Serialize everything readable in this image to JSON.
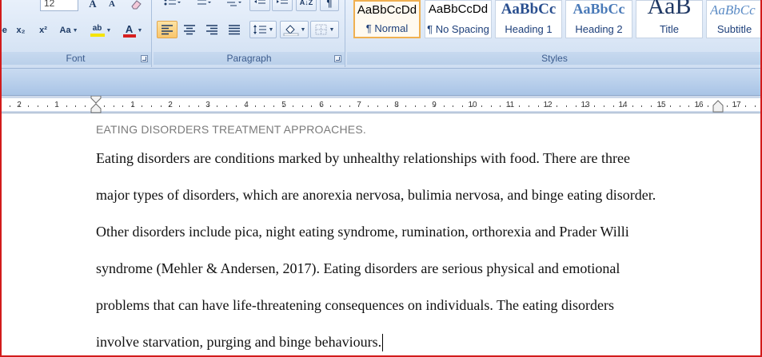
{
  "ribbon": {
    "font_group": {
      "label": "Font",
      "font_size": "12",
      "grow_label": "A",
      "shrink_label": "A",
      "strike_label": "abe",
      "subscript_label": "x₂",
      "superscript_label": "x²",
      "change_case_label": "Aa",
      "highlight_label": "ab",
      "font_color_label": "A",
      "highlight_color": "#f5e400",
      "font_color": "#d61f1f"
    },
    "paragraph_group": {
      "label": "Paragraph",
      "sort_label": "A↓Z",
      "show_marks_label": "¶"
    },
    "styles_group": {
      "label": "Styles",
      "styles": [
        {
          "sample": "AaBbCcDd",
          "name": "¶ Normal",
          "selected": true
        },
        {
          "sample": "AaBbCcDd",
          "name": "¶ No Spacing",
          "selected": false
        },
        {
          "sample": "AaBbCc",
          "name": "Heading 1",
          "selected": false
        },
        {
          "sample": "AaBbCc",
          "name": "Heading 2",
          "selected": false
        },
        {
          "sample": "AaB",
          "name": "Title",
          "selected": false
        },
        {
          "sample": "AaBbCc",
          "name": "Subtitle",
          "selected": false
        }
      ]
    }
  },
  "ruler": {
    "left_numbers": [
      "2",
      "1"
    ],
    "right_numbers": [
      "1",
      "2",
      "3",
      "4",
      "5",
      "6",
      "7",
      "8",
      "9",
      "10",
      "11",
      "12",
      "13",
      "14",
      "15",
      "16",
      "17"
    ]
  },
  "document": {
    "heading": "EATING DISORDERS TREATMENT APPROACHES.",
    "lines": [
      "Eating disorders are conditions marked by unhealthy relationships with food. There are three",
      "major types of disorders, which are anorexia nervosa, bulimia nervosa, and binge eating disorder.",
      "Other disorders include pica, night eating syndrome, rumination, orthorexia and Prader Willi",
      "syndrome (Mehler & Andersen, 2017). Eating disorders are serious physical and emotional",
      "problems that can have life-threatening consequences on individuals.  The eating disorders",
      "involve starvation, purging and binge behaviours."
    ]
  },
  "colors": {
    "frame": "#d21b1b",
    "ribbon_text": "#1e3b66",
    "style_name_text": "#1d3f7a",
    "heading_text": "#7b7b7b"
  }
}
